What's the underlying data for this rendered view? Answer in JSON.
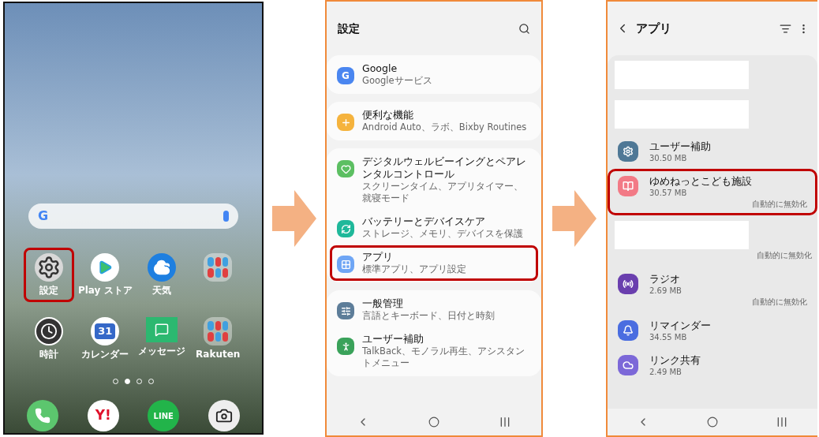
{
  "home_screen": {
    "search_bar": {
      "logo": "G"
    },
    "apps": [
      {
        "kind": "settings",
        "label": "設定",
        "highlighted": true
      },
      {
        "kind": "play",
        "label": "Play ストア",
        "highlighted": false
      },
      {
        "kind": "weather",
        "label": "天気",
        "highlighted": false
      },
      {
        "kind": "folder",
        "highlighted": false
      },
      {
        "kind": "clock",
        "label": "時計",
        "highlighted": false
      },
      {
        "kind": "calendar",
        "label": "カレンダー",
        "highlighted": false,
        "badge": "31"
      },
      {
        "kind": "message",
        "label": "メッセージ",
        "highlighted": false
      },
      {
        "kind": "folder",
        "label": "Rakuten",
        "highlighted": false
      }
    ],
    "page_dots": [
      {
        "selected": false
      },
      {
        "selected": true
      },
      {
        "selected": false
      },
      {
        "selected": false
      }
    ],
    "dock": [
      {
        "kind": "phone"
      },
      {
        "kind": "yahoo",
        "label": "Y!"
      },
      {
        "kind": "line",
        "label": "LINE"
      },
      {
        "kind": "camera"
      }
    ]
  },
  "settings_screen": {
    "title": "設定",
    "groups": [
      [
        {
          "title": "Google",
          "subtitle": "Googleサービス",
          "color": "#4a86f0",
          "logo": "G",
          "highlighted": false
        }
      ],
      [
        {
          "title": "便利な機能",
          "subtitle": "Android Auto、ラボ、Bixby Routines",
          "color": "#f5b33d",
          "highlighted": false
        }
      ],
      [
        {
          "title": "デジタルウェルビーイングとペアレンタルコントロール",
          "subtitle": "スクリーンタイム、アプリタイマー、就寝モード",
          "color": "#5cbf62",
          "highlighted": false
        },
        {
          "title": "バッテリーとデバイスケア",
          "subtitle": "ストレージ、メモリ、デバイスを保護",
          "color": "#1fb89a",
          "highlighted": false
        },
        {
          "title": "アプリ",
          "subtitle": "標準アプリ、アプリ設定",
          "color": "#6fa6f5",
          "highlighted": true
        }
      ],
      [
        {
          "title": "一般管理",
          "subtitle": "言語とキーボード、日付と時刻",
          "color": "#5d7d99",
          "highlighted": false
        },
        {
          "title": "ユーザー補助",
          "subtitle": "TalkBack、モノラル再生、アシスタントメニュー",
          "color": "#3aa25a",
          "highlighted": false
        }
      ]
    ]
  },
  "apps_screen": {
    "title": "アプリ",
    "items": [
      {
        "kind": "redacted",
        "highlighted": false
      },
      {
        "kind": "redacted",
        "highlighted": false
      },
      {
        "kind": "app",
        "name": "ユーザー補助",
        "size": "30.50 MB",
        "color": "#4f7896",
        "highlighted": false
      },
      {
        "kind": "app",
        "name": "ゆめねっとこども施設",
        "size": "30.57 MB",
        "status": "自動的に無効化",
        "color": "#f27a86",
        "highlighted": true
      },
      {
        "kind": "redacted",
        "status": "自動的に無効化",
        "highlighted": false
      },
      {
        "kind": "app",
        "name": "ラジオ",
        "size": "2.69 MB",
        "status": "自動的に無効化",
        "color": "#6a3fae",
        "highlighted": false
      },
      {
        "kind": "app",
        "name": "リマインダー",
        "size": "34.55 MB",
        "color": "#4a6de0",
        "highlighted": false
      },
      {
        "kind": "app",
        "name": "リンク共有",
        "size": "2.49 MB",
        "color": "#7c68d8",
        "highlighted": false
      }
    ]
  }
}
